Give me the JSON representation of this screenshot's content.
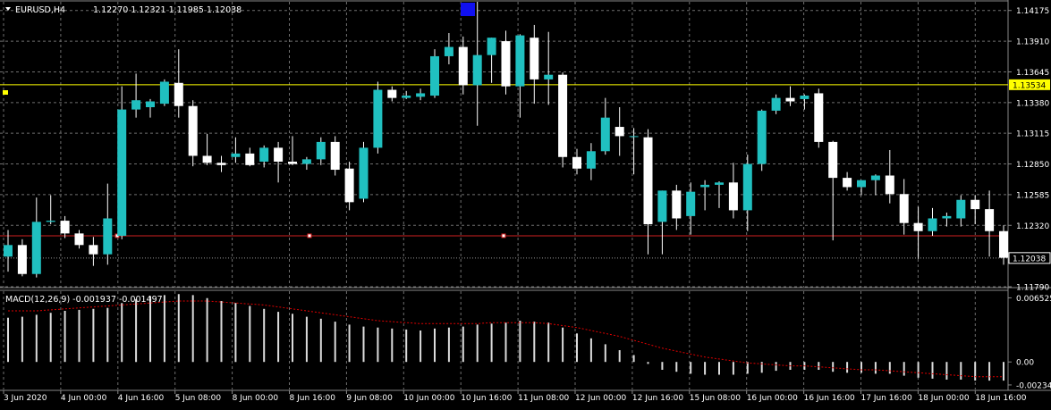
{
  "header": {
    "symbol": "EURUSD,H4",
    "ohlc": "1.12270 1.12321 1.11985 1.12038"
  },
  "macd_label": "MACD(12,26,9) -0.001937 -0.001497",
  "colors": {
    "background": "#000000",
    "grid": "#6f6f6f",
    "bull": "#20c0c0",
    "bear": "#ffffff",
    "wick": "#ffffff",
    "yellow_line": "#ffff00",
    "red_line": "#d02020",
    "signal": "#e00000",
    "text": "#ffffff"
  },
  "chart_data": [
    {
      "type": "candlestick",
      "title": "EURUSD,H4",
      "ylim": [
        1.1179,
        1.1425
      ],
      "y_ticks": [
        "1.14175",
        "1.13910",
        "1.13645",
        "1.13380",
        "1.13115",
        "1.12850",
        "1.12585",
        "1.12320",
        "1.11790"
      ],
      "price_tags": [
        {
          "name": "yellow-horizontal-line-tag",
          "label": "1.13534",
          "value": 1.13534
        },
        {
          "name": "bid-price-tag",
          "label": "1.12038",
          "value": 1.12038
        }
      ],
      "horizontal_lines": [
        {
          "name": "yellow-horizontal-line",
          "value": 1.13534,
          "color": "#ffff00"
        },
        {
          "name": "red-horizontal-line",
          "value": 1.1223,
          "color": "#d02020"
        }
      ],
      "x_labels": [
        "3 Jun 2020",
        "4 Jun 00:00",
        "4 Jun 16:00",
        "5 Jun 08:00",
        "8 Jun 00:00",
        "8 Jun 16:00",
        "9 Jun 08:00",
        "10 Jun 00:00",
        "10 Jun 16:00",
        "11 Jun 08:00",
        "12 Jun 00:00",
        "12 Jun 16:00",
        "15 Jun 08:00",
        "16 Jun 00:00",
        "16 Jun 16:00",
        "17 Jun 16:00",
        "18 Jun 00:00",
        "18 Jun 16:00"
      ],
      "candles": [
        {
          "o": 1.1205,
          "h": 1.1228,
          "l": 1.1192,
          "c": 1.1215
        },
        {
          "o": 1.1215,
          "h": 1.122,
          "l": 1.1188,
          "c": 1.119
        },
        {
          "o": 1.119,
          "h": 1.1256,
          "l": 1.1187,
          "c": 1.1235
        },
        {
          "o": 1.1235,
          "h": 1.1258,
          "l": 1.1233,
          "c": 1.1236
        },
        {
          "o": 1.1236,
          "h": 1.124,
          "l": 1.1221,
          "c": 1.1225
        },
        {
          "o": 1.1225,
          "h": 1.1228,
          "l": 1.1212,
          "c": 1.1215
        },
        {
          "o": 1.1215,
          "h": 1.1222,
          "l": 1.1197,
          "c": 1.1207
        },
        {
          "o": 1.1207,
          "h": 1.1268,
          "l": 1.1198,
          "c": 1.1238
        },
        {
          "o": 1.1223,
          "h": 1.1352,
          "l": 1.122,
          "c": 1.1332
        },
        {
          "o": 1.1332,
          "h": 1.1363,
          "l": 1.1325,
          "c": 1.134
        },
        {
          "o": 1.1334,
          "h": 1.1341,
          "l": 1.1325,
          "c": 1.1339
        },
        {
          "o": 1.1337,
          "h": 1.1358,
          "l": 1.1335,
          "c": 1.1356
        },
        {
          "o": 1.1355,
          "h": 1.1384,
          "l": 1.1325,
          "c": 1.1335
        },
        {
          "o": 1.1335,
          "h": 1.134,
          "l": 1.1283,
          "c": 1.1292
        },
        {
          "o": 1.1292,
          "h": 1.1311,
          "l": 1.1284,
          "c": 1.1286
        },
        {
          "o": 1.1286,
          "h": 1.1292,
          "l": 1.1278,
          "c": 1.1284
        },
        {
          "o": 1.1291,
          "h": 1.1308,
          "l": 1.1286,
          "c": 1.1294
        },
        {
          "o": 1.1294,
          "h": 1.1299,
          "l": 1.1283,
          "c": 1.1284
        },
        {
          "o": 1.1287,
          "h": 1.1301,
          "l": 1.1282,
          "c": 1.1299
        },
        {
          "o": 1.1299,
          "h": 1.1304,
          "l": 1.1269,
          "c": 1.1287
        },
        {
          "o": 1.1287,
          "h": 1.1309,
          "l": 1.1284,
          "c": 1.1285
        },
        {
          "o": 1.1285,
          "h": 1.1291,
          "l": 1.128,
          "c": 1.1289
        },
        {
          "o": 1.1289,
          "h": 1.1308,
          "l": 1.1284,
          "c": 1.1304
        },
        {
          "o": 1.1304,
          "h": 1.1309,
          "l": 1.1275,
          "c": 1.128
        },
        {
          "o": 1.1281,
          "h": 1.1287,
          "l": 1.1245,
          "c": 1.1252
        },
        {
          "o": 1.1255,
          "h": 1.1304,
          "l": 1.1252,
          "c": 1.1299
        },
        {
          "o": 1.1299,
          "h": 1.1356,
          "l": 1.1294,
          "c": 1.1349
        },
        {
          "o": 1.1349,
          "h": 1.1352,
          "l": 1.1339,
          "c": 1.1342
        },
        {
          "o": 1.1342,
          "h": 1.1348,
          "l": 1.1341,
          "c": 1.1344
        },
        {
          "o": 1.1343,
          "h": 1.135,
          "l": 1.134,
          "c": 1.1346
        },
        {
          "o": 1.1344,
          "h": 1.1384,
          "l": 1.1342,
          "c": 1.1378
        },
        {
          "o": 1.1378,
          "h": 1.1398,
          "l": 1.1371,
          "c": 1.1386
        },
        {
          "o": 1.1386,
          "h": 1.1395,
          "l": 1.1345,
          "c": 1.1353
        },
        {
          "o": 1.1353,
          "h": 1.1425,
          "l": 1.1318,
          "c": 1.1379
        },
        {
          "o": 1.1379,
          "h": 1.1394,
          "l": 1.1355,
          "c": 1.1394
        },
        {
          "o": 1.1391,
          "h": 1.14,
          "l": 1.1345,
          "c": 1.1352
        },
        {
          "o": 1.1352,
          "h": 1.1397,
          "l": 1.1325,
          "c": 1.1396
        },
        {
          "o": 1.1394,
          "h": 1.1405,
          "l": 1.1337,
          "c": 1.1358
        },
        {
          "o": 1.1358,
          "h": 1.1399,
          "l": 1.1336,
          "c": 1.1362
        },
        {
          "o": 1.1362,
          "h": 1.1364,
          "l": 1.1282,
          "c": 1.1291
        },
        {
          "o": 1.1291,
          "h": 1.1298,
          "l": 1.1276,
          "c": 1.1281
        },
        {
          "o": 1.1281,
          "h": 1.1303,
          "l": 1.1271,
          "c": 1.1296
        },
        {
          "o": 1.1296,
          "h": 1.1342,
          "l": 1.1293,
          "c": 1.1325
        },
        {
          "o": 1.1317,
          "h": 1.1334,
          "l": 1.1292,
          "c": 1.1309
        },
        {
          "o": 1.1309,
          "h": 1.1316,
          "l": 1.1276,
          "c": 1.1309
        },
        {
          "o": 1.1308,
          "h": 1.1315,
          "l": 1.1207,
          "c": 1.1233
        },
        {
          "o": 1.1235,
          "h": 1.1262,
          "l": 1.1207,
          "c": 1.1262
        },
        {
          "o": 1.1262,
          "h": 1.1267,
          "l": 1.1228,
          "c": 1.1238
        },
        {
          "o": 1.124,
          "h": 1.1269,
          "l": 1.1224,
          "c": 1.1261
        },
        {
          "o": 1.1265,
          "h": 1.1271,
          "l": 1.1245,
          "c": 1.1267
        },
        {
          "o": 1.1267,
          "h": 1.127,
          "l": 1.1247,
          "c": 1.1269
        },
        {
          "o": 1.1269,
          "h": 1.1286,
          "l": 1.1238,
          "c": 1.1245
        },
        {
          "o": 1.1245,
          "h": 1.1293,
          "l": 1.1227,
          "c": 1.1285
        },
        {
          "o": 1.1285,
          "h": 1.1332,
          "l": 1.1279,
          "c": 1.1331
        },
        {
          "o": 1.1331,
          "h": 1.1345,
          "l": 1.1328,
          "c": 1.1342
        },
        {
          "o": 1.1342,
          "h": 1.1352,
          "l": 1.1335,
          "c": 1.1339
        },
        {
          "o": 1.1341,
          "h": 1.1345,
          "l": 1.1332,
          "c": 1.1344
        },
        {
          "o": 1.1346,
          "h": 1.135,
          "l": 1.1299,
          "c": 1.1304
        },
        {
          "o": 1.1304,
          "h": 1.1305,
          "l": 1.1219,
          "c": 1.1273
        },
        {
          "o": 1.1273,
          "h": 1.1278,
          "l": 1.1262,
          "c": 1.1265
        },
        {
          "o": 1.1265,
          "h": 1.1271,
          "l": 1.1258,
          "c": 1.1271
        },
        {
          "o": 1.1271,
          "h": 1.1276,
          "l": 1.1258,
          "c": 1.1275
        },
        {
          "o": 1.1275,
          "h": 1.1297,
          "l": 1.1251,
          "c": 1.1259
        },
        {
          "o": 1.1259,
          "h": 1.1272,
          "l": 1.1224,
          "c": 1.1234
        },
        {
          "o": 1.1234,
          "h": 1.1248,
          "l": 1.1203,
          "c": 1.1227
        },
        {
          "o": 1.1227,
          "h": 1.1247,
          "l": 1.1223,
          "c": 1.1238
        },
        {
          "o": 1.1238,
          "h": 1.1243,
          "l": 1.1231,
          "c": 1.124
        },
        {
          "o": 1.1238,
          "h": 1.1258,
          "l": 1.1231,
          "c": 1.1254
        },
        {
          "o": 1.1254,
          "h": 1.1258,
          "l": 1.1233,
          "c": 1.1246
        },
        {
          "o": 1.1246,
          "h": 1.1262,
          "l": 1.1205,
          "c": 1.1227
        },
        {
          "o": 1.1227,
          "h": 1.1232,
          "l": 1.1198,
          "c": 1.1204
        }
      ]
    },
    {
      "type": "histogram",
      "title": "MACD(12,26,9)",
      "ylim": [
        -0.0028,
        0.0072
      ],
      "y_ticks": [
        "0.006525",
        "0.00",
        "-0.00234"
      ],
      "macd": [
        0.0045,
        0.0046,
        0.0048,
        0.005,
        0.0052,
        0.0053,
        0.0054,
        0.0055,
        0.006,
        0.0064,
        0.0067,
        0.0068,
        0.0069,
        0.0068,
        0.0065,
        0.0062,
        0.006,
        0.0057,
        0.0054,
        0.0051,
        0.0049,
        0.0046,
        0.0044,
        0.0041,
        0.0038,
        0.0036,
        0.0035,
        0.0034,
        0.0033,
        0.0032,
        0.0034,
        0.0035,
        0.0036,
        0.0038,
        0.0039,
        0.004,
        0.0042,
        0.0041,
        0.004,
        0.0035,
        0.0029,
        0.0024,
        0.0018,
        0.0012,
        0.0007,
        -0.0002,
        -0.0008,
        -0.001,
        -0.0012,
        -0.0013,
        -0.0013,
        -0.0013,
        -0.0012,
        -0.0011,
        -0.0009,
        -0.0008,
        -0.0008,
        -0.0008,
        -0.001,
        -0.0011,
        -0.0011,
        -0.0012,
        -0.0012,
        -0.0014,
        -0.0016,
        -0.0017,
        -0.0018,
        -0.0018,
        -0.0019,
        -0.0019,
        -0.0019
      ],
      "signal": [
        0.0052,
        0.0052,
        0.0052,
        0.0053,
        0.0054,
        0.0055,
        0.0056,
        0.0057,
        0.0058,
        0.0059,
        0.006,
        0.0061,
        0.0062,
        0.0062,
        0.0062,
        0.0061,
        0.006,
        0.0059,
        0.0058,
        0.0056,
        0.0054,
        0.0052,
        0.005,
        0.0048,
        0.0046,
        0.0044,
        0.0042,
        0.0041,
        0.004,
        0.0039,
        0.0039,
        0.0039,
        0.0039,
        0.0039,
        0.004,
        0.004,
        0.004,
        0.004,
        0.0039,
        0.0037,
        0.0035,
        0.0032,
        0.0029,
        0.0026,
        0.0022,
        0.0018,
        0.0014,
        0.0011,
        0.0008,
        0.0005,
        0.0003,
        0.0001,
        -0.0001,
        -0.0002,
        -0.0003,
        -0.0004,
        -0.0004,
        -0.0005,
        -0.0006,
        -0.0007,
        -0.0008,
        -0.0008,
        -0.0009,
        -0.001,
        -0.0011,
        -0.0012,
        -0.0013,
        -0.0014,
        -0.0015,
        -0.0015,
        -0.0015
      ]
    }
  ]
}
